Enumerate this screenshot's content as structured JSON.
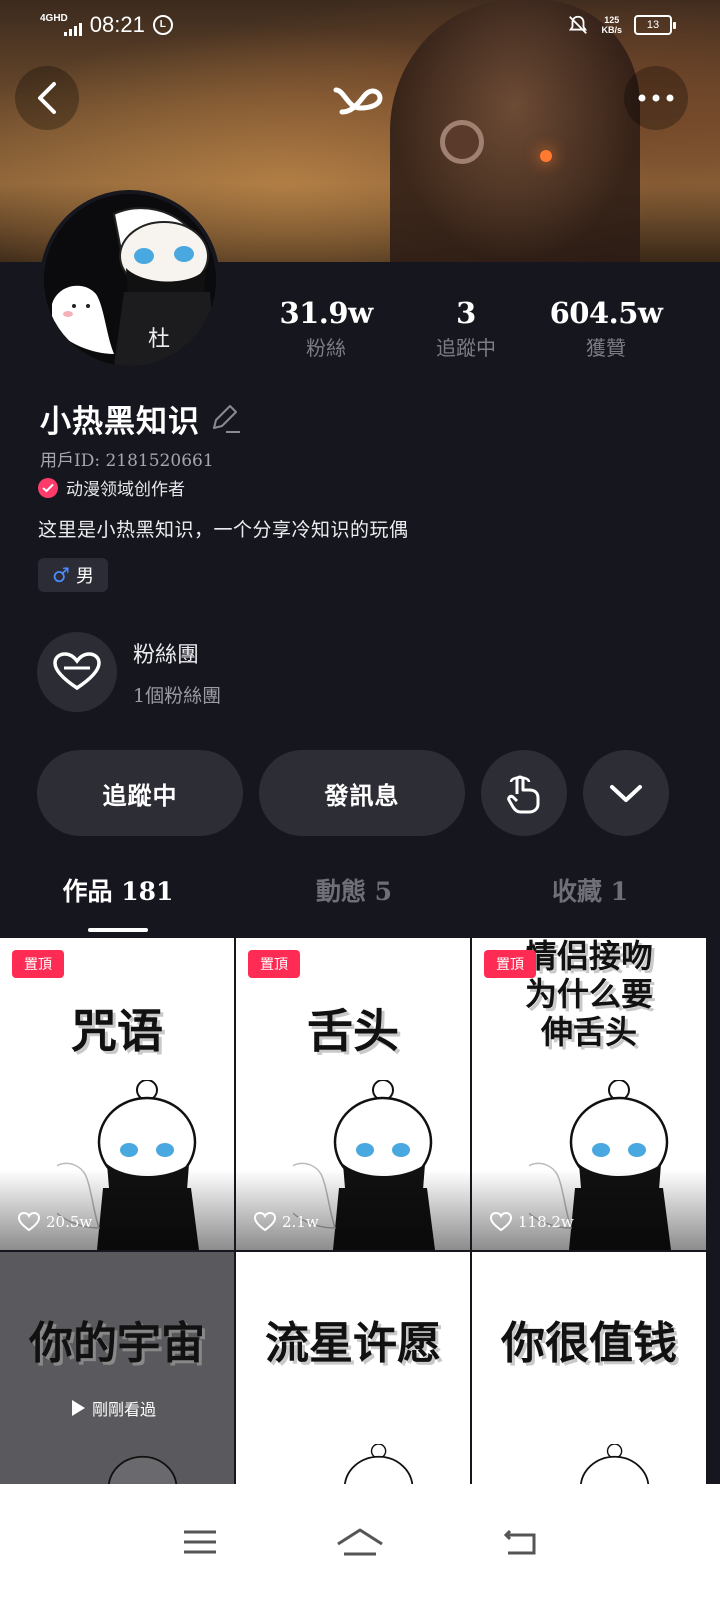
{
  "status_bar": {
    "network": "4GHD",
    "time": "08:21",
    "license_icon": "L",
    "speed_value": "125",
    "speed_unit": "KB/s",
    "battery": "13"
  },
  "profile": {
    "name": "小热黑知识",
    "user_id": "用戶ID: 2181520661",
    "verified_label": "动漫领域创作者",
    "bio": "这里是小热黑知识，一个分享冷知识的玩偶",
    "gender_symbol": "♂",
    "gender_label": "男",
    "avatar_text": "杜"
  },
  "stats": [
    {
      "value": "31.9w",
      "label": "粉絲"
    },
    {
      "value": "3",
      "label": "追蹤中"
    },
    {
      "value": "604.5w",
      "label": "獲贊"
    }
  ],
  "fan_club": {
    "title": "粉絲團",
    "subtitle": "1個粉絲團"
  },
  "actions": {
    "follow": "追蹤中",
    "message": "發訊息"
  },
  "tabs": [
    {
      "label": "作品 181"
    },
    {
      "label": "動態 5"
    },
    {
      "label": "收藏 1"
    }
  ],
  "videos": [
    {
      "pinned": "置頂",
      "title": "咒语",
      "likes": "20.5w"
    },
    {
      "pinned": "置頂",
      "title": "舌头",
      "likes": "2.1w"
    },
    {
      "pinned": "置頂",
      "title": "情侣接吻\n为什么要\n伸舌头",
      "likes": "118.2w"
    },
    {
      "title": "你的宇宙",
      "seen": "剛剛看過"
    },
    {
      "title": "流星许愿"
    },
    {
      "title": "你很值钱"
    }
  ],
  "colors": {
    "background": "#16161e",
    "accent": "#fe2c55",
    "button": "#2d2d35",
    "gender_blue": "#4d8dff"
  }
}
